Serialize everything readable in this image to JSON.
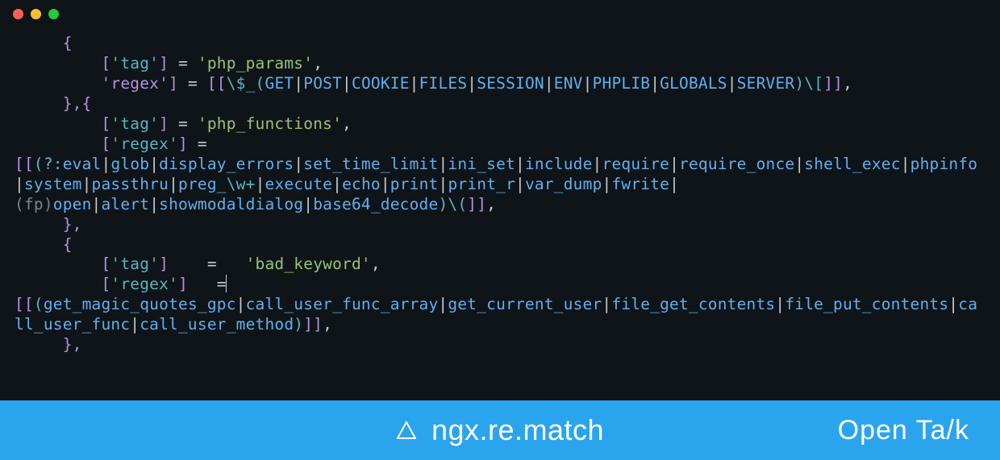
{
  "window": {
    "traffic": {
      "close": "close",
      "min": "minimize",
      "max": "maximize"
    }
  },
  "code": {
    "l1_indent": "     ",
    "open_brace": "{",
    "l2_indent": "         ",
    "lbrack": "[",
    "rbrack": "]",
    "tag_key": "'tag'",
    "regex_key": "'regex'",
    "eq_sp": " = ",
    "comma": ",",
    "str_php_params": "'php_params'",
    "str_php_functions": "'php_functions'",
    "str_bad_keyword": "'bad_keyword'",
    "dbl_lb": "[[",
    "dbl_rb": "]]",
    "close_brace": "}",
    "close_comma": "},",
    "close_open": "},{",
    "regex1_pre": "\\$_(",
    "regex1_alts": [
      "GET",
      "POST",
      "COOKIE",
      "FILES",
      "SESSION",
      "ENV",
      "PHPLIB",
      "GLOBALS",
      "SERVER"
    ],
    "regex1_post": ")\\[",
    "regex2_pre": "(?:",
    "regex2_alts_a": [
      "eval",
      "glob",
      "display_errors",
      "set_time_limit",
      "ini_set",
      "include",
      "require",
      "require_once",
      "shell_exec",
      "phpinfo",
      "system",
      "passthru"
    ],
    "regex2_preg": "preg_",
    "regex2_wplus": "\\w+",
    "regex2_alts_b": [
      "execute",
      "echo",
      "print",
      "print_r",
      "var_dump",
      "fwrite"
    ],
    "regex2_fp_open": "(fp)",
    "regex2_open": "open",
    "regex2_alts_c": [
      "alert",
      "showmodaldialog",
      "base64_decode"
    ],
    "regex2_post": ")\\(",
    "regex3_pre": "(",
    "regex3_alts": [
      "get_magic_quotes_gpc",
      "call_user_func_array",
      "get_current_user",
      "file_get_contents",
      "file_put_contents",
      "call_user_func",
      "call_user_method"
    ],
    "regex3_post": ")",
    "tag_pad": "    =   ",
    "regex_pad": "   ="
  },
  "footer": {
    "title": "ngx.re.match",
    "brand": "Open Ta/k"
  }
}
